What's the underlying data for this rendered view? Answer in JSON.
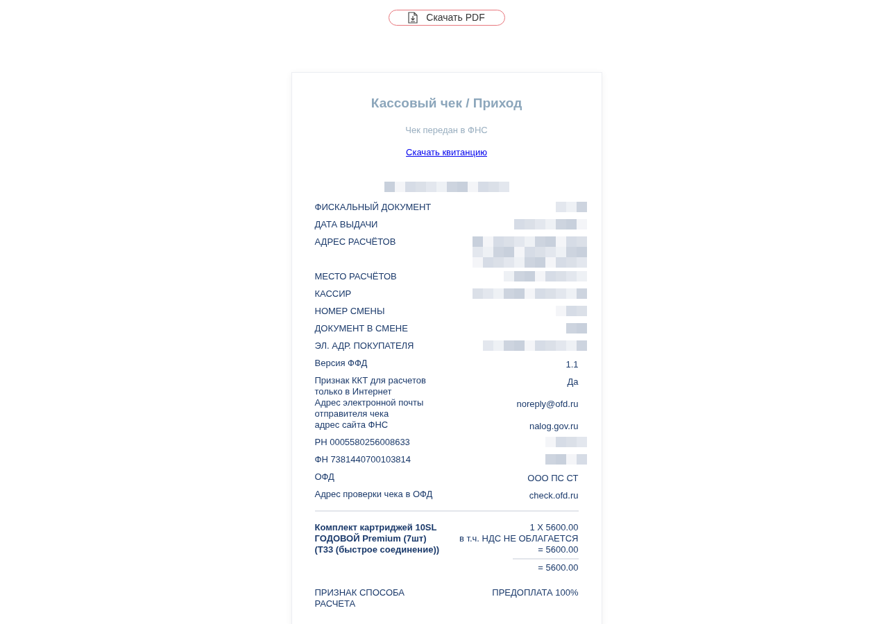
{
  "download_button": {
    "label": "Скачать PDF"
  },
  "receipt": {
    "title": "Кассовый чек / Приход",
    "status": "Чек передан в ФНС",
    "receipt_link": "Скачать квитанцию",
    "rows": [
      {
        "kind": "redacted",
        "label": "ФИСКАЛЬНЫЙ ДОКУМЕНТ"
      },
      {
        "kind": "redacted",
        "label": "ДАТА ВЫДАЧИ"
      },
      {
        "kind": "redacted_tall",
        "label": "АДРЕС РАСЧЁТОВ"
      },
      {
        "kind": "redacted",
        "label": "МЕСТО РАСЧЁТОВ"
      },
      {
        "kind": "redacted",
        "label": "КАССИР"
      },
      {
        "kind": "redacted",
        "label": "НОМЕР СМЕНЫ"
      },
      {
        "kind": "redacted",
        "label": "ДОКУМЕНТ В СМЕНЕ"
      },
      {
        "kind": "redacted",
        "label": "ЭЛ. АДР. ПОКУПАТЕЛЯ"
      },
      {
        "kind": "text",
        "label": "Версия ФФД",
        "value": "1.1"
      },
      {
        "kind": "text",
        "label": "Признак ККТ для расчетов только в Интернет",
        "value": "Да"
      },
      {
        "kind": "text",
        "label": "Адрес электронной почты отправителя чека",
        "value": "noreply@ofd.ru"
      },
      {
        "kind": "text",
        "label": "адрес сайта ФНС",
        "value": "nalog.gov.ru"
      },
      {
        "kind": "redacted",
        "label": "РН 0005580256008633"
      },
      {
        "kind": "redacted",
        "label": "ФН 7381440700103814"
      },
      {
        "kind": "text",
        "label": "ОФД",
        "value": "ООО ПС СТ"
      },
      {
        "kind": "text",
        "label": "Адрес проверки чека в ОФД",
        "value": "check.ofd.ru"
      }
    ],
    "item": {
      "name": "Комплект картриджей 10SL ГОДОВОЙ Premium (7шт) (Т33 (быстрое соединение))",
      "quantity_price": "1 X 5600.00",
      "tax": "в т.ч. НДС НЕ ОБЛАГАЕТСЯ = 5600.00",
      "total": "= 5600.00"
    },
    "payment_rows": [
      {
        "label": "ПРИЗНАК СПОСОБА РАСЧЕТА",
        "value": "ПРЕДОПЛАТА 100%"
      }
    ]
  }
}
